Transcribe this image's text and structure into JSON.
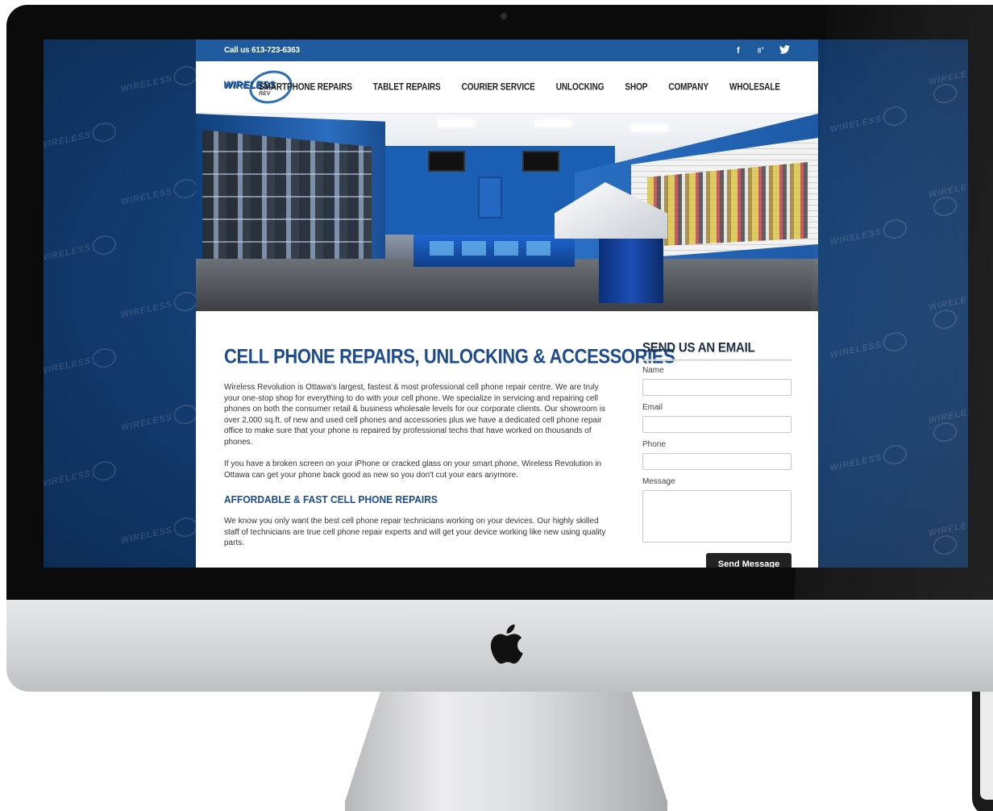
{
  "topbar": {
    "call": "Call us 613-723-6363",
    "social": [
      "f",
      "8+",
      "✓"
    ]
  },
  "logo": {
    "text": "WIRELESS",
    "sub": "REV"
  },
  "nav": [
    "SMARTPHONE REPAIRS",
    "TABLET REPAIRS",
    "COURIER SERVICE",
    "UNLOCKING",
    "SHOP",
    "COMPANY",
    "WHOLESALE"
  ],
  "main": {
    "title": "CELL PHONE REPAIRS, UNLOCKING & ACCESSORIES",
    "para1": "Wireless Revolution is Ottawa's largest, fastest & most professional cell phone repair centre. We are truly your one-stop shop for everything to do with your cell phone. We specialize in servicing and repairing cell phones on both the consumer retail & business wholesale levels for our corporate clients. Our showroom is over 2,000 sq.ft. of new and used cell phones and accessories plus we have a dedicated cell phone repair office to make sure that your phone is repaired by professional techs that have worked on thousands of phones.",
    "para2": "If you have a broken screen on your iPhone or cracked glass on your smart phone, Wireless Revolution in Ottawa can get your phone back good as new so you don't cut your ears anymore.",
    "subtitle": "AFFORDABLE & FAST CELL PHONE REPAIRS",
    "para3": "We know you only want the best cell phone repair technicians working on your devices. Our highly skilled staff of technicians are true cell phone repair experts and will get your device working like new using quality parts."
  },
  "form": {
    "title": "SEND US AN EMAIL",
    "name_label": "Name",
    "email_label": "Email",
    "phone_label": "Phone",
    "message_label": "Message",
    "name_value": "",
    "email_value": "",
    "phone_value": "",
    "message_value": "",
    "submit": "Send Message"
  },
  "watermark": "WIRELESS",
  "colors": {
    "topbar": "#1f5a9e",
    "heading": "#1c4c8f",
    "button": "#222222",
    "background": "#143f74"
  }
}
